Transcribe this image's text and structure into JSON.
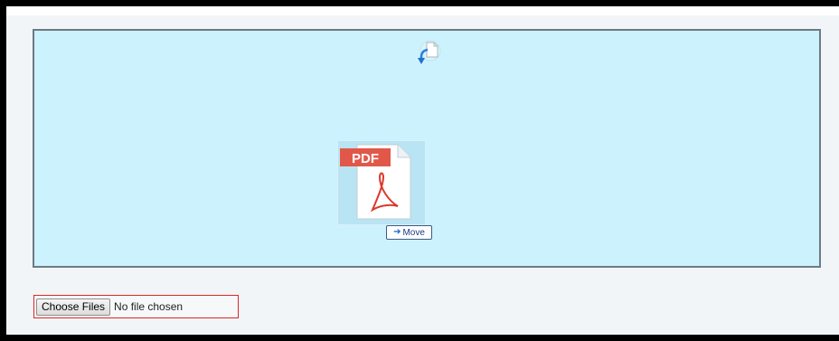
{
  "upload": {
    "move_label": "Move",
    "pdf_label": "PDF",
    "choose_files_label": "Choose Files",
    "no_file_text": "No file chosen"
  },
  "icons": {
    "drop_indicator": "drop-arrow-icon",
    "dragged_file": "pdf-file-icon",
    "move_arrow": "right-arrow-icon"
  },
  "colors": {
    "dropzone_bg": "#ccf2fd",
    "pdf_red": "#e1584a",
    "file_input_border": "#e02727"
  }
}
